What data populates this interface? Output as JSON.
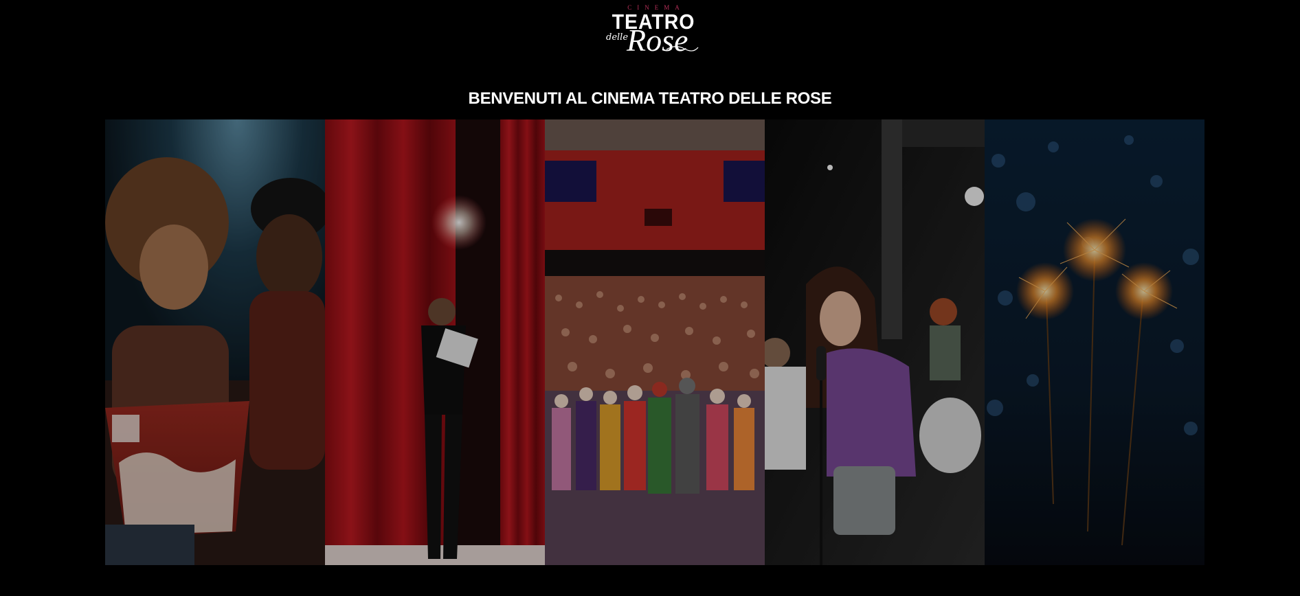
{
  "logo": {
    "cinema": "CINEMA",
    "teatro": "TEATRO",
    "delle": "delle",
    "rose": "Rose"
  },
  "welcome_title": "BENVENUTI AL CINEMA TEATRO DELLE ROSE",
  "gallery": {
    "panels": [
      {
        "name": "gallery-image-couple-popcorn"
      },
      {
        "name": "gallery-image-actor-stage"
      },
      {
        "name": "gallery-image-theatre-audience"
      },
      {
        "name": "gallery-image-girl-singing"
      },
      {
        "name": "gallery-image-sparklers"
      }
    ]
  },
  "colors": {
    "background": "#000000",
    "text": "#ffffff",
    "logo_accent": "#b7305a"
  }
}
